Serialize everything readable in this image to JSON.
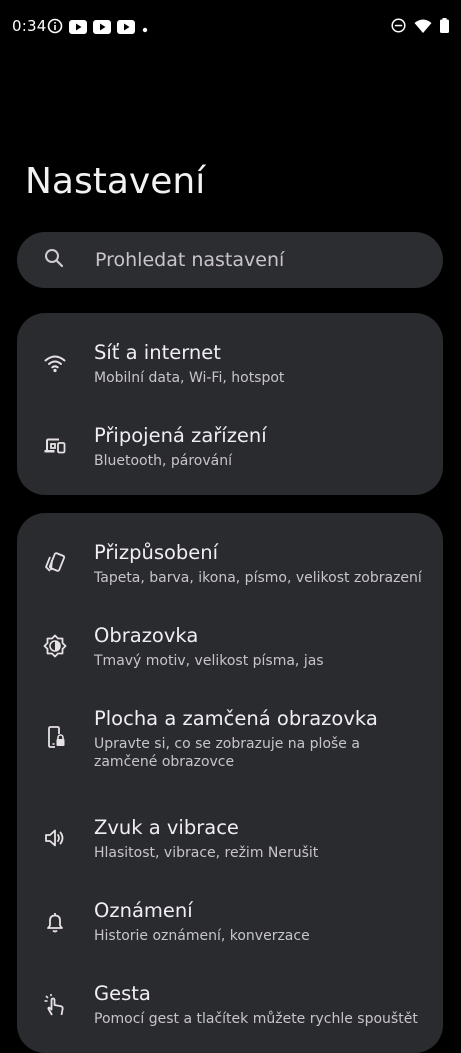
{
  "status_bar": {
    "time": "0:34"
  },
  "page": {
    "title": "Nastavení"
  },
  "search": {
    "placeholder": "Prohledat nastavení"
  },
  "groups": [
    {
      "items": [
        {
          "title": "Síť a internet",
          "subtitle": "Mobilní data, Wi-Fi, hotspot",
          "icon": "wifi-icon"
        },
        {
          "title": "Připojená zařízení",
          "subtitle": "Bluetooth, párování",
          "icon": "connected-devices-icon"
        }
      ]
    },
    {
      "items": [
        {
          "title": "Přizpůsobení",
          "subtitle": "Tapeta, barva, ikona, písmo, velikost zobrazení",
          "icon": "palette-icon"
        },
        {
          "title": "Obrazovka",
          "subtitle": "Tmavý motiv, velikost písma, jas",
          "icon": "brightness-icon"
        },
        {
          "title": "Plocha a zamčená obrazovka",
          "subtitle": "Upravte si, co se zobrazuje na ploše a zamčené obrazovce",
          "icon": "phone-lock-icon"
        },
        {
          "title": "Zvuk a vibrace",
          "subtitle": "Hlasitost, vibrace, režim Nerušit",
          "icon": "volume-icon"
        },
        {
          "title": "Oznámení",
          "subtitle": "Historie oznámení, konverzace",
          "icon": "bell-icon"
        },
        {
          "title": "Gesta",
          "subtitle": "Pomocí gest a tlačítek můžete rychle spouštět",
          "icon": "gesture-icon"
        }
      ]
    }
  ]
}
